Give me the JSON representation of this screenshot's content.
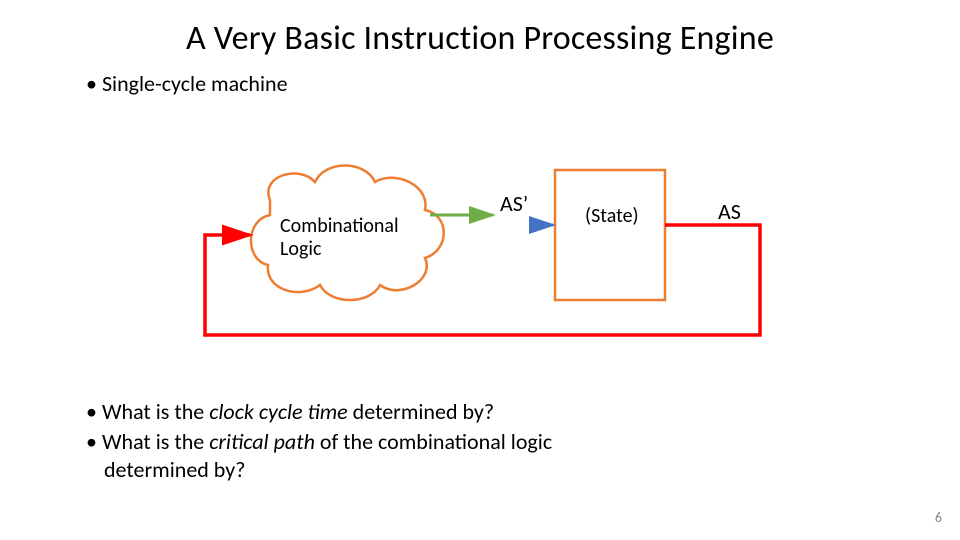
{
  "title": "A Very Basic Instruction Processing Engine",
  "bullets": {
    "b1": "Single-cycle machine",
    "b2_pre": "What is the ",
    "b2_em": "clock cycle time",
    "b2_post": " determined by?",
    "b3_pre": "What is the ",
    "b3_em": "critical path",
    "b3_post": " of the combinational logic",
    "b3_line2": "determined by?"
  },
  "diagram": {
    "cloud_label_l1": "Combinational",
    "cloud_label_l2": "Logic",
    "state_label": "(State)",
    "as_prime": "AS’",
    "as": "AS"
  },
  "page_number": "6",
  "colors": {
    "orange": "#ED7D31",
    "red": "#FF0000",
    "blue": "#4472C4",
    "green": "#70AD47"
  }
}
